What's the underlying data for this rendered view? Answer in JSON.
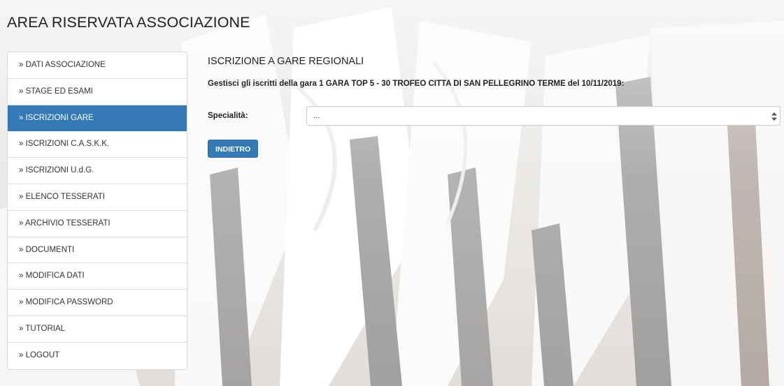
{
  "header": {
    "title": "AREA RISERVATA ASSOCIAZIONE"
  },
  "sidebar": {
    "active_index": 2,
    "accent_color": "#337ab7",
    "items": [
      {
        "label": "» DATI ASSOCIAZIONE"
      },
      {
        "label": "» STAGE ED ESAMI"
      },
      {
        "label": "» ISCRIZIONI GARE"
      },
      {
        "label": "» ISCRIZIONI C.A.S.K.K."
      },
      {
        "label": "» ISCRIZIONI U.d.G."
      },
      {
        "label": "» ELENCO TESSERATI"
      },
      {
        "label": "» ARCHIVIO TESSERATI"
      },
      {
        "label": "» DOCUMENTI"
      },
      {
        "label": "» MODIFICA DATI"
      },
      {
        "label": "» MODIFICA PASSWORD"
      },
      {
        "label": "» TUTORIAL"
      },
      {
        "label": "» LOGOUT"
      }
    ]
  },
  "main": {
    "section_title": "ISCRIZIONE A GARE REGIONALI",
    "subtitle": "Gestisci gli iscritti della gara 1 GARA TOP 5 - 30 TROFEO CITTA DI SAN PELLEGRINO TERME del 10/11/2019:",
    "form": {
      "specialita_label": "Specialità:",
      "specialita_value": "..."
    },
    "back_button_label": "INDIETRO"
  },
  "icons": {
    "select_arrows": "select-arrows-icon"
  }
}
